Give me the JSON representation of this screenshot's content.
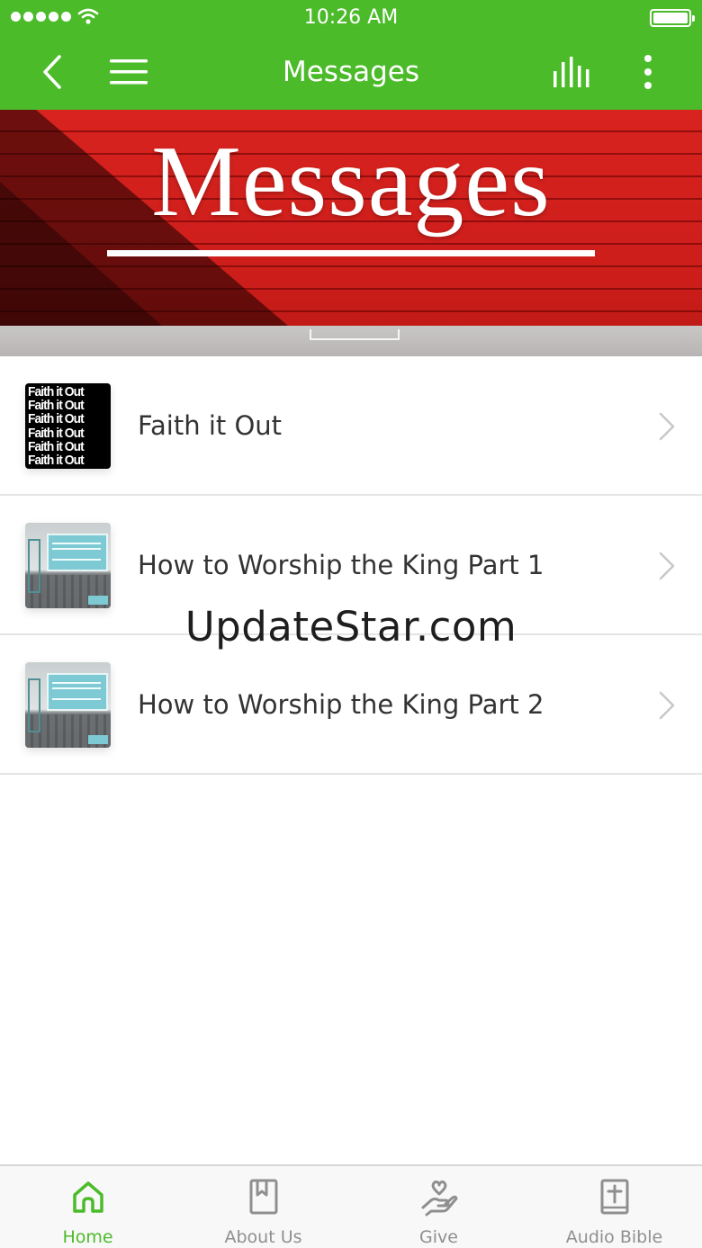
{
  "status_bar": {
    "time": "10:26 AM"
  },
  "nav": {
    "title": "Messages"
  },
  "hero": {
    "title": "Messages"
  },
  "messages": [
    {
      "title": "Faith it Out",
      "thumbnail": "faith-it-out-artwork",
      "thumb_text": "Faith it Out"
    },
    {
      "title": "How to Worship the King Part 1",
      "thumbnail": "worship-king-artwork"
    },
    {
      "title": "How to Worship the King Part 2",
      "thumbnail": "worship-king-artwork"
    }
  ],
  "watermark": "UpdateStar.com",
  "tabs": [
    {
      "label": "Home",
      "icon": "home-icon",
      "active": true
    },
    {
      "label": "About Us",
      "icon": "book-icon",
      "active": false
    },
    {
      "label": "Give",
      "icon": "give-hand-heart-icon",
      "active": false
    },
    {
      "label": "Audio Bible",
      "icon": "bible-icon",
      "active": false
    }
  ],
  "colors": {
    "brand_green": "#4cbb2a",
    "hero_red": "#d8231f",
    "tab_inactive": "#8f8f8f"
  }
}
